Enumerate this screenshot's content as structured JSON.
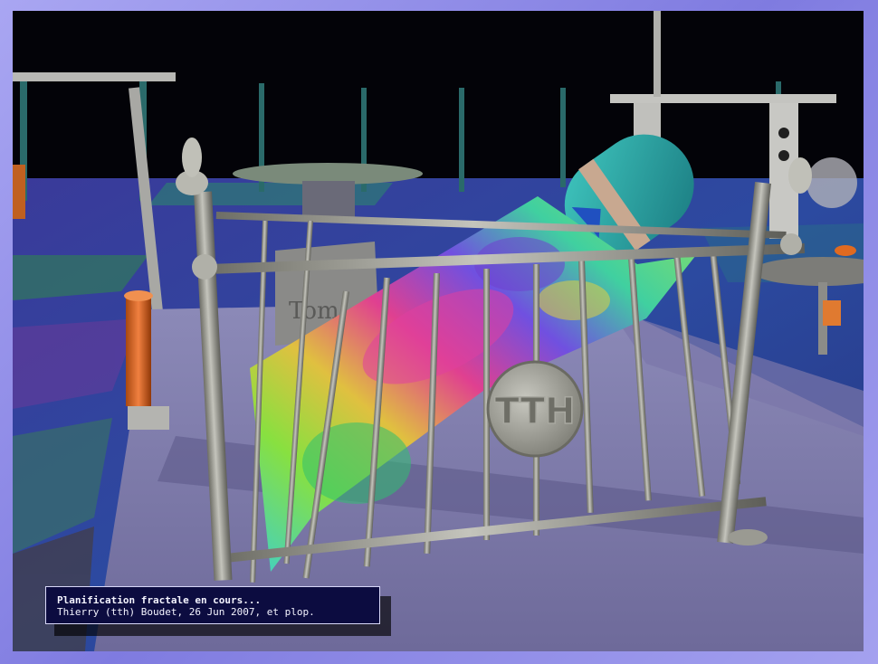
{
  "scene": {
    "description_icon": "rendered-3d-scene",
    "plaque_text": "TTH",
    "tombstone_text": "Tom"
  },
  "caption": {
    "line1": "Planification fractale en cours...",
    "line2": "Thierry (tth) Boudet, 26 Jun 2007, et plop."
  },
  "colors": {
    "frame": "#8a86e6",
    "caption_bg": "#0c0c40",
    "caption_text": "#f4f4ff",
    "metal": "#9a9a90"
  }
}
